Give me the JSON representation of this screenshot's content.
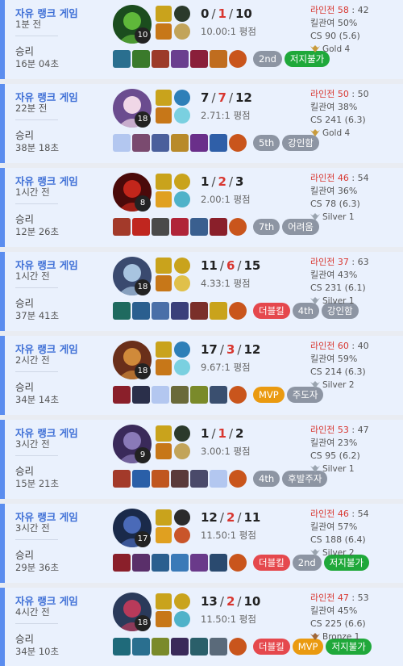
{
  "accent": "#5b8def",
  "matches": [
    {
      "game_type": "자유 랭크 게임",
      "time_ago": "1분 전",
      "result": "승리",
      "duration": "16분 04초",
      "champion_level": "10",
      "champ_colors": [
        "#1b4d1e",
        "#5fb83a"
      ],
      "spells": [
        "#c9a31c",
        "#c77718"
      ],
      "runes": [
        "#2b3a2b",
        "#c2a45a"
      ],
      "kda": {
        "k": "0",
        "d": "1",
        "a": "10"
      },
      "ratio": "10.00:1 평점",
      "items": [
        "#2a6f8f",
        "#3a7a2b",
        "#9c3b2a",
        "#6a3f8f",
        "#8a1f3a",
        "#c06d1f",
        "#c9551c"
      ],
      "badges": [
        {
          "label": "2nd",
          "color": "gray"
        },
        {
          "label": "저지불가",
          "color": "green"
        }
      ],
      "lane_label": "라인전",
      "lane_score": "58",
      "lane_sep": ":",
      "lane_opp": "42",
      "kp": "킬관여 50%",
      "cs": "CS 90 (5.6)",
      "tier": "Gold 4",
      "tier_color": "#c89b3c"
    },
    {
      "game_type": "자유 랭크 게임",
      "time_ago": "22분 전",
      "result": "승리",
      "duration": "38분 18초",
      "champion_level": "18",
      "champ_colors": [
        "#6b4c8f",
        "#f0d7e7"
      ],
      "spells": [
        "#c9a31c",
        "#c77718"
      ],
      "runes": [
        "#2e7fb8",
        "#7ad0e0"
      ],
      "kda": {
        "k": "7",
        "d": "7",
        "a": "12"
      },
      "ratio": "2.71:1 평점",
      "items": [
        "",
        "#7a4a6f",
        "#4a5f9c",
        "#b88a2a",
        "#6a2f8a",
        "#2f5fa8",
        "#c9551c"
      ],
      "badges": [
        {
          "label": "5th",
          "color": "gray"
        },
        {
          "label": "강인함",
          "color": "gray"
        }
      ],
      "lane_label": "라인전",
      "lane_score": "50",
      "lane_sep": ":",
      "lane_opp": "50",
      "kp": "킬관여 38%",
      "cs": "CS 241 (6.3)",
      "tier": "Gold 4",
      "tier_color": "#c89b3c"
    },
    {
      "game_type": "자유 랭크 게임",
      "time_ago": "1시간 전",
      "result": "승리",
      "duration": "12분 26초",
      "champion_level": "8",
      "champ_colors": [
        "#4a0a0a",
        "#c2261b"
      ],
      "spells": [
        "#c9a31c",
        "#e0a020"
      ],
      "runes": [
        "#c9a31c",
        "#4fb2c9"
      ],
      "kda": {
        "k": "1",
        "d": "2",
        "a": "3"
      },
      "ratio": "2.00:1 평점",
      "items": [
        "#a33a2a",
        "#c0261f",
        "#4a4a4a",
        "#b02438",
        "#3a5f8f",
        "#8a1f2a",
        "#c9551c"
      ],
      "badges": [
        {
          "label": "7th",
          "color": "gray"
        },
        {
          "label": "어려움",
          "color": "gray"
        }
      ],
      "lane_label": "라인전",
      "lane_score": "46",
      "lane_sep": ":",
      "lane_opp": "54",
      "kp": "킬관여 36%",
      "cs": "CS 78 (6.3)",
      "tier": "Silver 1",
      "tier_color": "#9aa4af"
    },
    {
      "game_type": "자유 랭크 게임",
      "time_ago": "1시간 전",
      "result": "승리",
      "duration": "37분 41초",
      "champion_level": "18",
      "champ_colors": [
        "#3a4a6f",
        "#a8c4e0"
      ],
      "spells": [
        "#c9a31c",
        "#c77718"
      ],
      "runes": [
        "#c9a31c",
        "#e0c04a"
      ],
      "kda": {
        "k": "11",
        "d": "6",
        "a": "15"
      },
      "ratio": "4.33:1 평점",
      "items": [
        "#1f6a5f",
        "#2a5f8f",
        "#4a6fa8",
        "#3a3f7a",
        "#7a2f2a",
        "#c9a31c",
        "#c9551c"
      ],
      "badges": [
        {
          "label": "더블킬",
          "color": "red"
        },
        {
          "label": "4th",
          "color": "gray"
        },
        {
          "label": "강인함",
          "color": "gray"
        }
      ],
      "lane_label": "라인전",
      "lane_score": "37",
      "lane_sep": ":",
      "lane_opp": "63",
      "kp": "킬관여 43%",
      "cs": "CS 231 (6.1)",
      "tier": "Silver 1",
      "tier_color": "#9aa4af"
    },
    {
      "game_type": "자유 랭크 게임",
      "time_ago": "2시간 전",
      "result": "승리",
      "duration": "34분 14초",
      "champion_level": "18",
      "champ_colors": [
        "#6a2f1a",
        "#d08a3a"
      ],
      "spells": [
        "#c9a31c",
        "#c77718"
      ],
      "runes": [
        "#2e7fb8",
        "#7ad0e0"
      ],
      "kda": {
        "k": "17",
        "d": "3",
        "a": "12"
      },
      "ratio": "9.67:1 평점",
      "items": [
        "#8a1f2a",
        "#2a2f4a",
        "",
        "#6a6a3a",
        "#7a8a2a",
        "#3a4f6f",
        "#c9551c"
      ],
      "badges": [
        {
          "label": "MVP",
          "color": "orange"
        },
        {
          "label": "주도자",
          "color": "gray"
        }
      ],
      "lane_label": "라인전",
      "lane_score": "60",
      "lane_sep": ":",
      "lane_opp": "40",
      "kp": "킬관여 59%",
      "cs": "CS 214 (6.3)",
      "tier": "Silver 2",
      "tier_color": "#9aa4af"
    },
    {
      "game_type": "자유 랭크 게임",
      "time_ago": "3시간 전",
      "result": "승리",
      "duration": "15분 21초",
      "champion_level": "9",
      "champ_colors": [
        "#3a2a5a",
        "#8a7ab8"
      ],
      "spells": [
        "#c9a31c",
        "#c77718"
      ],
      "runes": [
        "#2b3a2b",
        "#c2a45a"
      ],
      "kda": {
        "k": "1",
        "d": "1",
        "a": "2"
      },
      "ratio": "3.00:1 평점",
      "items": [
        "#a33a2a",
        "#2a5fa8",
        "#c0561f",
        "#5a3a3a",
        "#4a4a6a",
        "",
        "#c9551c"
      ],
      "badges": [
        {
          "label": "4th",
          "color": "gray"
        },
        {
          "label": "후발주자",
          "color": "gray"
        }
      ],
      "lane_label": "라인전",
      "lane_score": "53",
      "lane_sep": ":",
      "lane_opp": "47",
      "kp": "킬관여 23%",
      "cs": "CS 95 (6.2)",
      "tier": "Silver 1",
      "tier_color": "#9aa4af"
    },
    {
      "game_type": "자유 랭크 게임",
      "time_ago": "3시간 전",
      "result": "승리",
      "duration": "29분 36초",
      "champion_level": "17",
      "champ_colors": [
        "#1a2a4a",
        "#4a6ab8"
      ],
      "spells": [
        "#c9a31c",
        "#e0a020"
      ],
      "runes": [
        "#2b2b2b",
        "#c9552a"
      ],
      "kda": {
        "k": "12",
        "d": "2",
        "a": "11"
      },
      "ratio": "11.50:1 평점",
      "items": [
        "#8a1f2a",
        "#5a2f6a",
        "#2a5f8f",
        "#3a7ab8",
        "#6a3a8a",
        "#2a4a6f",
        "#c9551c"
      ],
      "badges": [
        {
          "label": "더블킬",
          "color": "red"
        },
        {
          "label": "2nd",
          "color": "gray"
        },
        {
          "label": "저지불가",
          "color": "green"
        }
      ],
      "lane_label": "라인전",
      "lane_score": "46",
      "lane_sep": ":",
      "lane_opp": "54",
      "kp": "킬관여 57%",
      "cs": "CS 188 (6.4)",
      "tier": "Silver 2",
      "tier_color": "#9aa4af"
    },
    {
      "game_type": "자유 랭크 게임",
      "time_ago": "4시간 전",
      "result": "승리",
      "duration": "34분 10초",
      "champion_level": "18",
      "champ_colors": [
        "#2a3a5a",
        "#b83a5a"
      ],
      "spells": [
        "#c9a31c",
        "#c77718"
      ],
      "runes": [
        "#c9a31c",
        "#4fb2c9"
      ],
      "kda": {
        "k": "13",
        "d": "2",
        "a": "10"
      },
      "ratio": "11.50:1 평점",
      "items": [
        "#1f6a7a",
        "#2a6f8f",
        "#7a8a2a",
        "#3a2a5a",
        "#2a5f6a",
        "#5a6a7a",
        "#c9551c"
      ],
      "badges": [
        {
          "label": "더블킬",
          "color": "red"
        },
        {
          "label": "MVP",
          "color": "orange"
        },
        {
          "label": "저지불가",
          "color": "green"
        }
      ],
      "lane_label": "라인전",
      "lane_score": "47",
      "lane_sep": ":",
      "lane_opp": "53",
      "kp": "킬관여 45%",
      "cs": "CS 225 (6.6)",
      "tier": "Bronze 1",
      "tier_color": "#a0683a"
    }
  ]
}
